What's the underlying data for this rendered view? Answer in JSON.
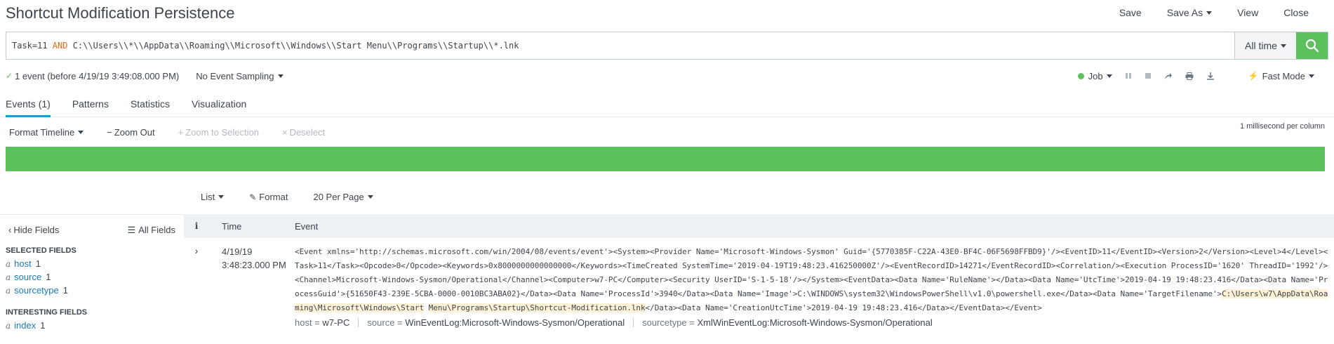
{
  "header": {
    "title": "Shortcut Modification Persistence",
    "actions": {
      "save": "Save",
      "save_as": "Save As",
      "view": "View",
      "close": "Close"
    }
  },
  "search": {
    "query_prefix": "Task=11 ",
    "query_keyword": "AND",
    "query_rest": " C:\\\\Users\\\\*\\\\AppData\\\\Roaming\\\\Microsoft\\\\Windows\\\\Start Menu\\\\Programs\\\\Startup\\\\*.lnk",
    "time_range": "All time",
    "search_icon": "search-icon"
  },
  "status": {
    "event_count": "1 event (before 4/19/19 3:49:08.000 PM)",
    "sampling": "No Event Sampling",
    "job": "Job",
    "mode": "Fast Mode"
  },
  "tabs": [
    "Events (1)",
    "Patterns",
    "Statistics",
    "Visualization"
  ],
  "timeline": {
    "format": "Format Timeline",
    "zoom_out": "Zoom Out",
    "zoom_selection": "Zoom to Selection",
    "deselect": "Deselect",
    "scale": "1 millisecond per column",
    "bar_color": "#5cc05c"
  },
  "results_toolbar": {
    "list": "List",
    "format": "Format",
    "per_page": "20 Per Page"
  },
  "sidebar": {
    "hide_fields": "Hide Fields",
    "all_fields": "All Fields",
    "selected_title": "SELECTED FIELDS",
    "selected": [
      {
        "type": "a",
        "name": "host",
        "count": "1"
      },
      {
        "type": "a",
        "name": "source",
        "count": "1"
      },
      {
        "type": "a",
        "name": "sourcetype",
        "count": "1"
      }
    ],
    "interesting_title": "INTERESTING FIELDS",
    "interesting": [
      {
        "type": "a",
        "name": "index",
        "count": "1"
      }
    ]
  },
  "table": {
    "col_info": "i",
    "col_time": "Time",
    "col_event": "Event",
    "row": {
      "date": "4/19/19",
      "time": "3:48:23.000 PM",
      "raw_before": "<Event xmlns='http://schemas.microsoft.com/win/2004/08/events/event'><System><Provider Name='Microsoft-Windows-Sysmon' Guid='{5770385F-C22A-43E0-BF4C-06F5698FFBD9}'/><EventID>11</EventID><Version>2</Version><Level>4</Level><Task>11</Task><Opcode>0</Opcode><Keywords>0x8000000000000000</Keywords><TimeCreated SystemTime='2019-04-19T19:48:23.416250000Z'/><EventRecordID>14271</EventRecordID><Correlation/><Execution ProcessID='1620' ThreadID='1992'/><Channel>Microsoft-Windows-Sysmon/Operational</Channel><Computer>w7-PC</Computer><Security UserID='S-1-5-18'/></System><EventData><Data Name='RuleName'></Data><Data Name='UtcTime'>2019-04-19 19:48:23.416</Data><Data Name='ProcessGuid'>{51650F43-239E-5CBA-0000-0010BC3ABA02}</Data><Data Name='ProcessId'>3940</Data><Data Name='Image'>C:\\WINDOWS\\system32\\WindowsPowerShell\\v1.0\\powershell.exe</Data><Data Name='TargetFilename'>",
      "raw_hl1": "C:\\Users\\w7\\AppData\\Roaming\\Microsoft\\Windows\\Start",
      "raw_space": " ",
      "raw_hl2": "Menu\\Programs\\Startup\\Shortcut-Modification.lnk",
      "raw_after": "</Data><Data Name='CreationUtcTime'>2019-04-19 19:48:23.416</Data></EventData></Event>",
      "meta_host_key": "host = ",
      "meta_host_val": "w7-PC",
      "meta_source_key": "source = ",
      "meta_source_val": "WinEventLog:Microsoft-Windows-Sysmon/Operational",
      "meta_st_key": "sourcetype = ",
      "meta_st_val": "XmlWinEventLog:Microsoft-Windows-Sysmon/Operational"
    }
  }
}
